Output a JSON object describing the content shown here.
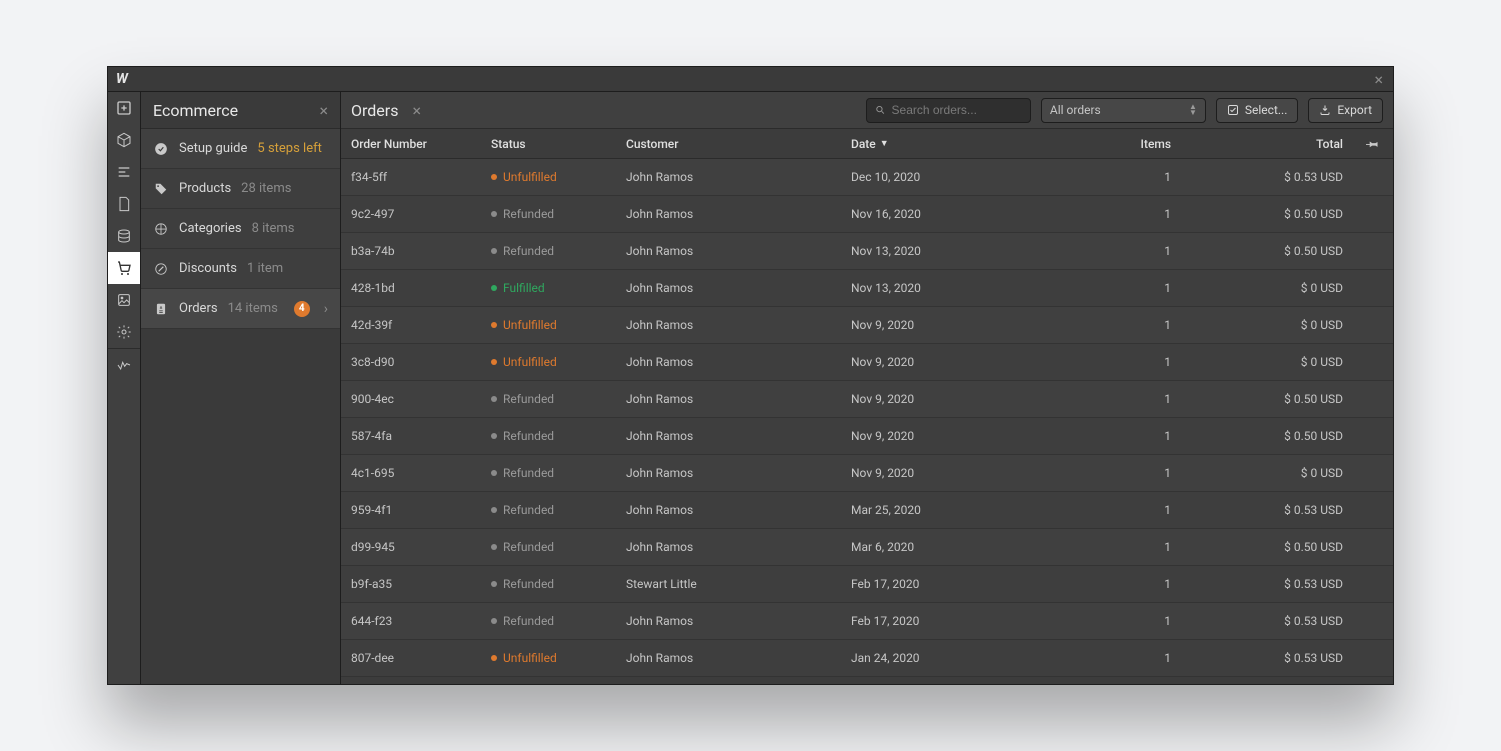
{
  "titleBar": {
    "logo": "W"
  },
  "sidebar": {
    "title": "Ecommerce",
    "setup": {
      "label": "Setup guide",
      "steps": "5 steps left"
    },
    "products": {
      "label": "Products",
      "count": "28 items"
    },
    "categories": {
      "label": "Categories",
      "count": "8 items"
    },
    "discounts": {
      "label": "Discounts",
      "count": "1 item"
    },
    "orders": {
      "label": "Orders",
      "count": "14 items",
      "badge": "4"
    }
  },
  "main": {
    "title": "Orders",
    "searchPlaceholder": "Search orders...",
    "filter": "All orders",
    "selectBtn": "Select...",
    "exportBtn": "Export",
    "columns": {
      "order": "Order Number",
      "status": "Status",
      "customer": "Customer",
      "date": "Date",
      "items": "Items",
      "total": "Total"
    },
    "rows": [
      {
        "order": "f34-5ff",
        "statusKey": "unfulfilled",
        "status": "Unfulfilled",
        "customer": "John Ramos",
        "date": "Dec 10, 2020",
        "items": "1",
        "total": "$ 0.53 USD"
      },
      {
        "order": "9c2-497",
        "statusKey": "refunded",
        "status": "Refunded",
        "customer": "John Ramos",
        "date": "Nov 16, 2020",
        "items": "1",
        "total": "$ 0.50 USD"
      },
      {
        "order": "b3a-74b",
        "statusKey": "refunded",
        "status": "Refunded",
        "customer": "John Ramos",
        "date": "Nov 13, 2020",
        "items": "1",
        "total": "$ 0.50 USD"
      },
      {
        "order": "428-1bd",
        "statusKey": "fulfilled",
        "status": "Fulfilled",
        "customer": "John Ramos",
        "date": "Nov 13, 2020",
        "items": "1",
        "total": "$ 0 USD"
      },
      {
        "order": "42d-39f",
        "statusKey": "unfulfilled",
        "status": "Unfulfilled",
        "customer": "John Ramos",
        "date": "Nov 9, 2020",
        "items": "1",
        "total": "$ 0 USD"
      },
      {
        "order": "3c8-d90",
        "statusKey": "unfulfilled",
        "status": "Unfulfilled",
        "customer": "John Ramos",
        "date": "Nov 9, 2020",
        "items": "1",
        "total": "$ 0 USD"
      },
      {
        "order": "900-4ec",
        "statusKey": "refunded",
        "status": "Refunded",
        "customer": "John Ramos",
        "date": "Nov 9, 2020",
        "items": "1",
        "total": "$ 0.50 USD"
      },
      {
        "order": "587-4fa",
        "statusKey": "refunded",
        "status": "Refunded",
        "customer": "John Ramos",
        "date": "Nov 9, 2020",
        "items": "1",
        "total": "$ 0.50 USD"
      },
      {
        "order": "4c1-695",
        "statusKey": "refunded",
        "status": "Refunded",
        "customer": "John Ramos",
        "date": "Nov 9, 2020",
        "items": "1",
        "total": "$ 0 USD"
      },
      {
        "order": "959-4f1",
        "statusKey": "refunded",
        "status": "Refunded",
        "customer": "John Ramos",
        "date": "Mar 25, 2020",
        "items": "1",
        "total": "$ 0.53 USD"
      },
      {
        "order": "d99-945",
        "statusKey": "refunded",
        "status": "Refunded",
        "customer": "John Ramos",
        "date": "Mar 6, 2020",
        "items": "1",
        "total": "$ 0.50 USD"
      },
      {
        "order": "b9f-a35",
        "statusKey": "refunded",
        "status": "Refunded",
        "customer": "Stewart Little",
        "date": "Feb 17, 2020",
        "items": "1",
        "total": "$ 0.53 USD"
      },
      {
        "order": "644-f23",
        "statusKey": "refunded",
        "status": "Refunded",
        "customer": "John Ramos",
        "date": "Feb 17, 2020",
        "items": "1",
        "total": "$ 0.53 USD"
      },
      {
        "order": "807-dee",
        "statusKey": "unfulfilled",
        "status": "Unfulfilled",
        "customer": "John Ramos",
        "date": "Jan 24, 2020",
        "items": "1",
        "total": "$ 0.53 USD"
      }
    ]
  }
}
